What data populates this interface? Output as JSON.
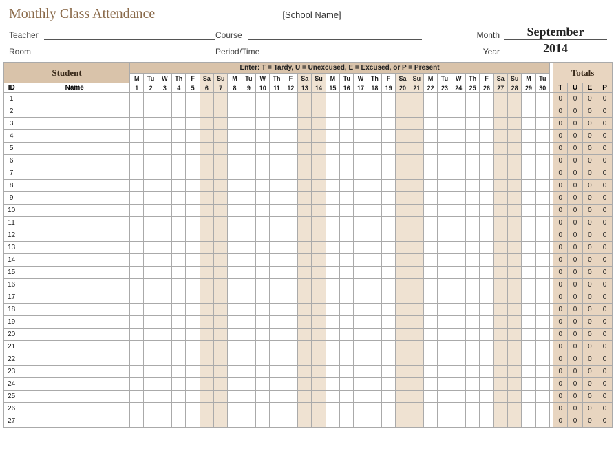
{
  "header": {
    "title": "Monthly Class Attendance",
    "school_name": "[School Name]",
    "labels": {
      "teacher": "Teacher",
      "course": "Course",
      "room": "Room",
      "period": "Period/Time",
      "month": "Month",
      "year": "Year"
    },
    "month_value": "September",
    "year_value": "2014"
  },
  "table": {
    "student_header": "Student",
    "legend": "Enter:  T = Tardy,  U = Unexcused,  E = Excused,  or P = Present",
    "totals_header": "Totals",
    "id_label": "ID",
    "name_label": "Name",
    "dow": [
      "M",
      "Tu",
      "W",
      "Th",
      "F",
      "Sa",
      "Su",
      "M",
      "Tu",
      "W",
      "Th",
      "F",
      "Sa",
      "Su",
      "M",
      "Tu",
      "W",
      "Th",
      "F",
      "Sa",
      "Su",
      "M",
      "Tu",
      "W",
      "Th",
      "F",
      "Sa",
      "Su",
      "M",
      "Tu"
    ],
    "days": [
      "1",
      "2",
      "3",
      "4",
      "5",
      "6",
      "7",
      "8",
      "9",
      "10",
      "11",
      "12",
      "13",
      "14",
      "15",
      "16",
      "17",
      "18",
      "19",
      "20",
      "21",
      "22",
      "23",
      "24",
      "25",
      "26",
      "27",
      "28",
      "29",
      "30"
    ],
    "weekend_idx": [
      5,
      6,
      12,
      13,
      19,
      20,
      26,
      27
    ],
    "totals_cols": [
      "T",
      "U",
      "E",
      "P"
    ],
    "rows": [
      {
        "id": "1",
        "totals": [
          0,
          0,
          0,
          0
        ]
      },
      {
        "id": "2",
        "totals": [
          0,
          0,
          0,
          0
        ]
      },
      {
        "id": "3",
        "totals": [
          0,
          0,
          0,
          0
        ]
      },
      {
        "id": "4",
        "totals": [
          0,
          0,
          0,
          0
        ]
      },
      {
        "id": "5",
        "totals": [
          0,
          0,
          0,
          0
        ]
      },
      {
        "id": "6",
        "totals": [
          0,
          0,
          0,
          0
        ]
      },
      {
        "id": "7",
        "totals": [
          0,
          0,
          0,
          0
        ]
      },
      {
        "id": "8",
        "totals": [
          0,
          0,
          0,
          0
        ]
      },
      {
        "id": "9",
        "totals": [
          0,
          0,
          0,
          0
        ]
      },
      {
        "id": "10",
        "totals": [
          0,
          0,
          0,
          0
        ]
      },
      {
        "id": "11",
        "totals": [
          0,
          0,
          0,
          0
        ]
      },
      {
        "id": "12",
        "totals": [
          0,
          0,
          0,
          0
        ]
      },
      {
        "id": "13",
        "totals": [
          0,
          0,
          0,
          0
        ]
      },
      {
        "id": "14",
        "totals": [
          0,
          0,
          0,
          0
        ]
      },
      {
        "id": "15",
        "totals": [
          0,
          0,
          0,
          0
        ]
      },
      {
        "id": "16",
        "totals": [
          0,
          0,
          0,
          0
        ]
      },
      {
        "id": "17",
        "totals": [
          0,
          0,
          0,
          0
        ]
      },
      {
        "id": "18",
        "totals": [
          0,
          0,
          0,
          0
        ]
      },
      {
        "id": "19",
        "totals": [
          0,
          0,
          0,
          0
        ]
      },
      {
        "id": "20",
        "totals": [
          0,
          0,
          0,
          0
        ]
      },
      {
        "id": "21",
        "totals": [
          0,
          0,
          0,
          0
        ]
      },
      {
        "id": "22",
        "totals": [
          0,
          0,
          0,
          0
        ]
      },
      {
        "id": "23",
        "totals": [
          0,
          0,
          0,
          0
        ]
      },
      {
        "id": "24",
        "totals": [
          0,
          0,
          0,
          0
        ]
      },
      {
        "id": "25",
        "totals": [
          0,
          0,
          0,
          0
        ]
      },
      {
        "id": "26",
        "totals": [
          0,
          0,
          0,
          0
        ]
      },
      {
        "id": "27",
        "totals": [
          0,
          0,
          0,
          0
        ]
      }
    ]
  }
}
